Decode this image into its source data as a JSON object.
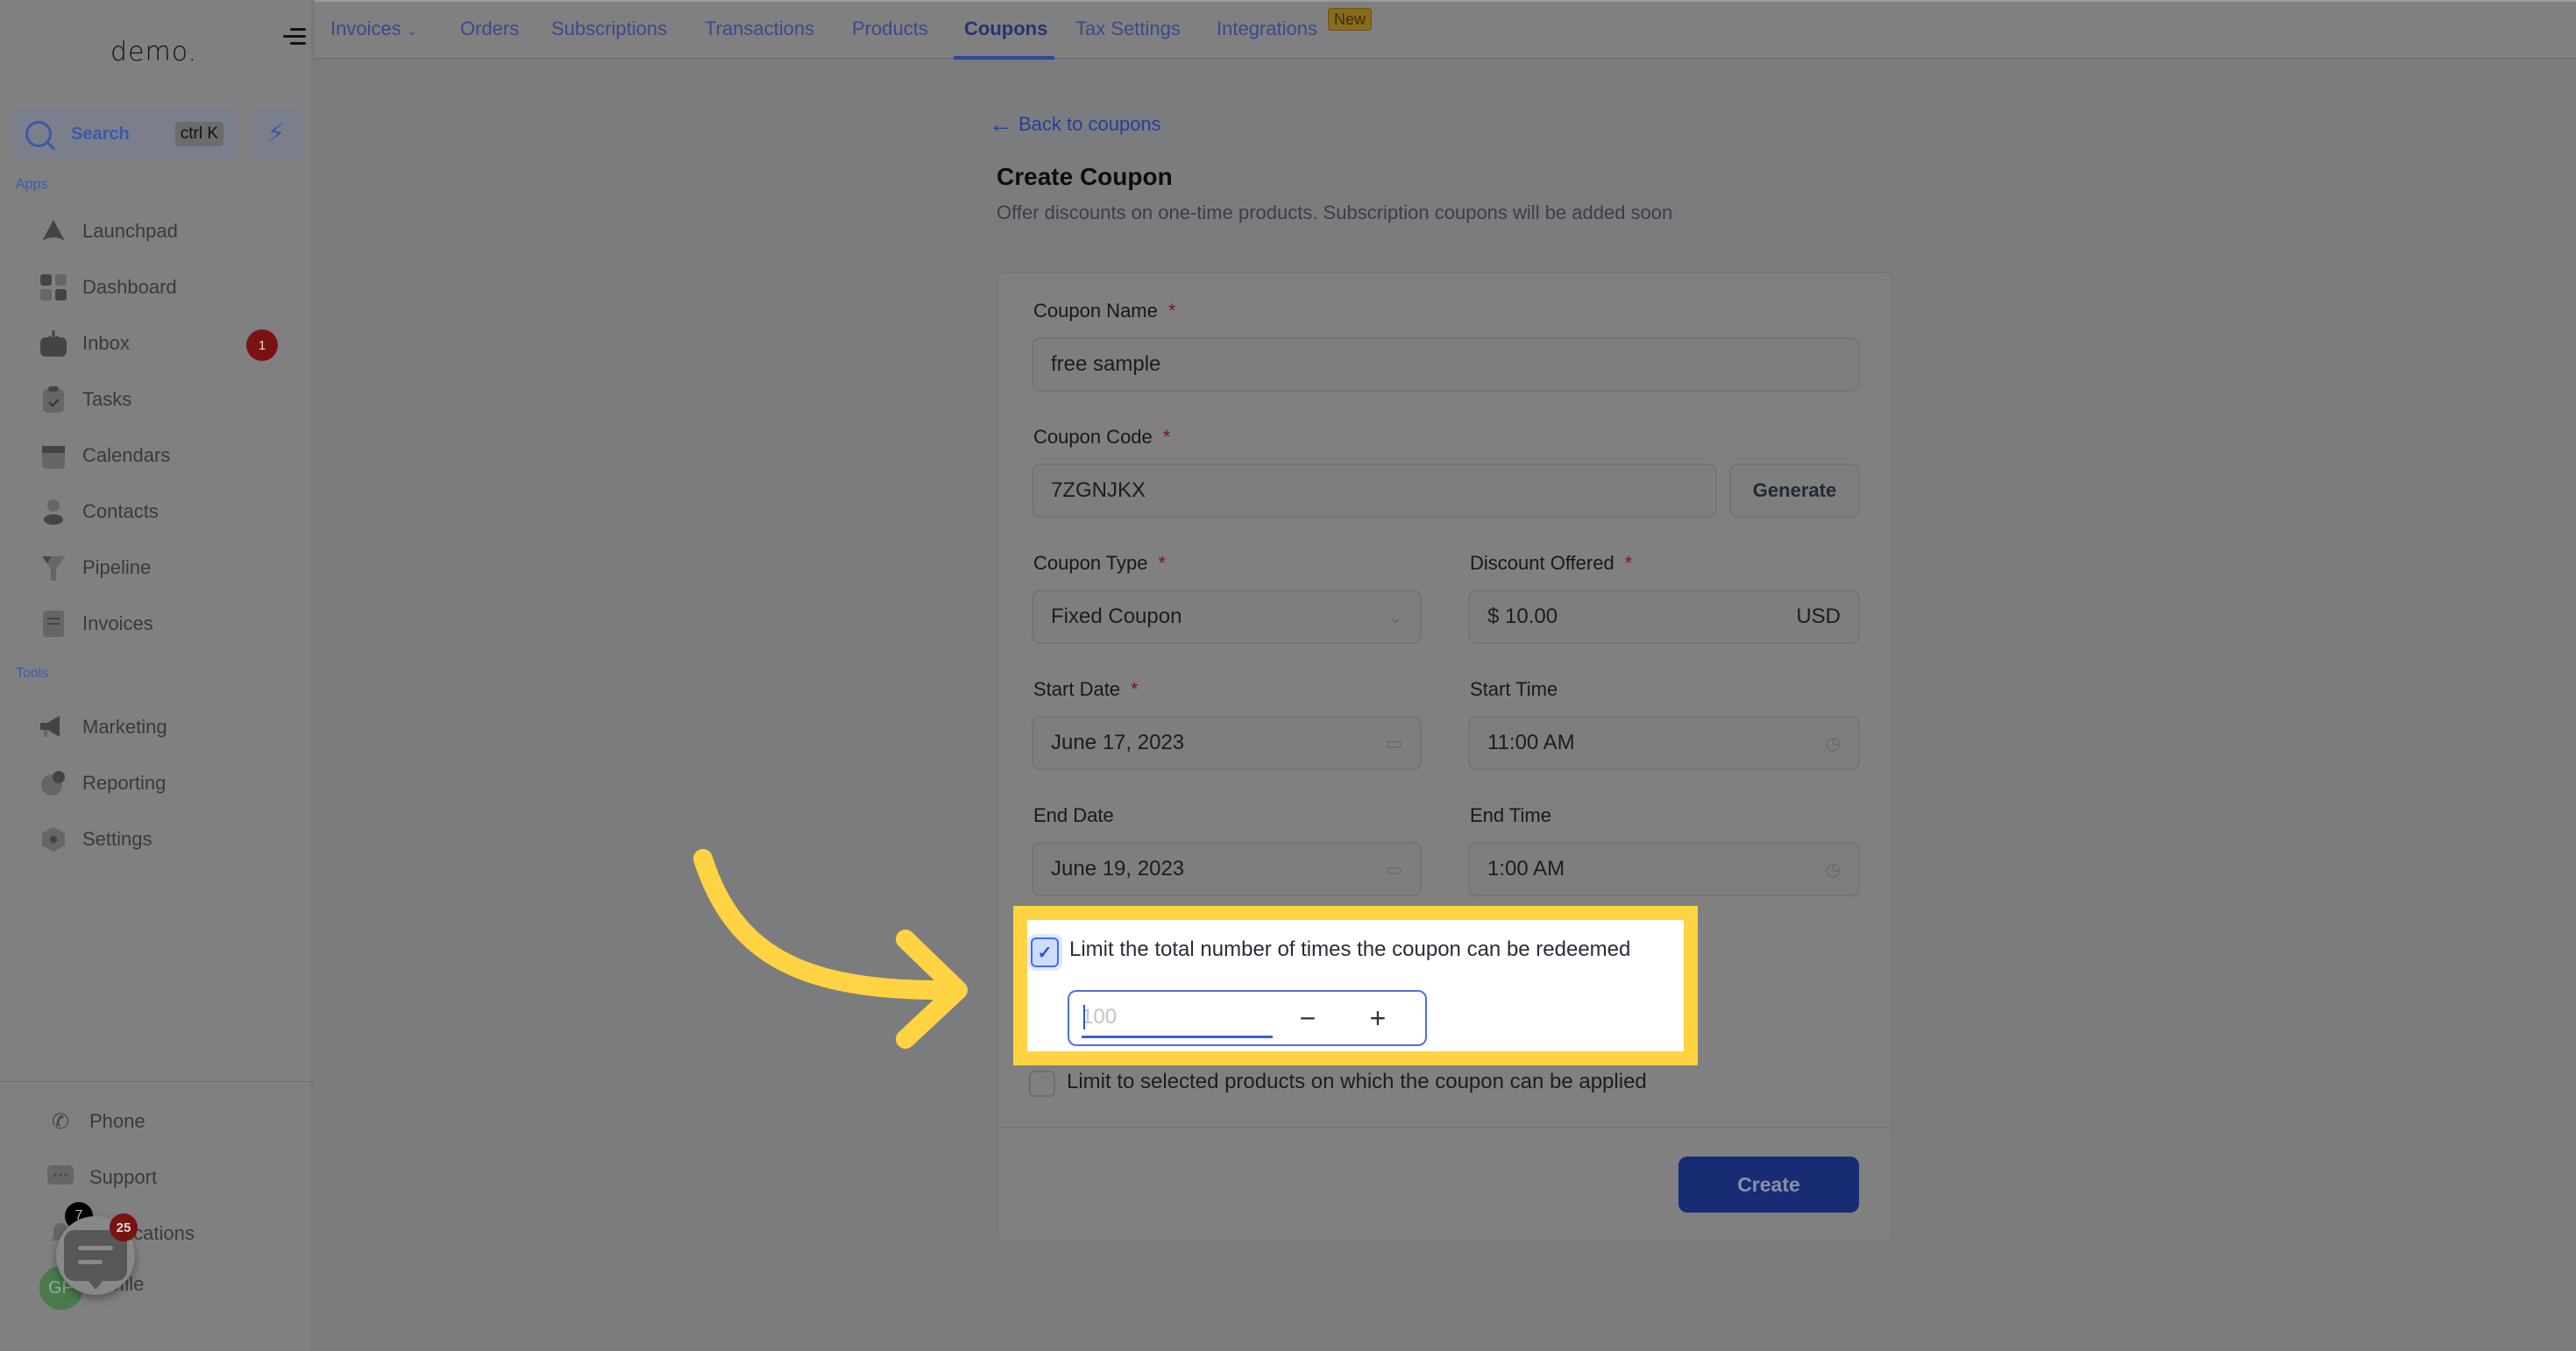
{
  "sidebar": {
    "logo": "demo.",
    "search": {
      "label": "Search",
      "shortcut": "ctrl K"
    },
    "apps_label": "Apps",
    "tools_label": "Tools",
    "apps": [
      {
        "label": "Launchpad",
        "icon": "rocket-icon"
      },
      {
        "label": "Dashboard",
        "icon": "grid-icon"
      },
      {
        "label": "Inbox",
        "icon": "inbox-icon",
        "badge": "1"
      },
      {
        "label": "Tasks",
        "icon": "clipboard-check-icon"
      },
      {
        "label": "Calendars",
        "icon": "calendar-icon"
      },
      {
        "label": "Contacts",
        "icon": "person-icon"
      },
      {
        "label": "Pipeline",
        "icon": "funnel-icon"
      },
      {
        "label": "Invoices",
        "icon": "receipt-icon"
      }
    ],
    "tools": [
      {
        "label": "Marketing",
        "icon": "megaphone-icon"
      },
      {
        "label": "Reporting",
        "icon": "pie-chart-icon"
      },
      {
        "label": "Settings",
        "icon": "gear-icon"
      }
    ],
    "bottom": [
      {
        "label": "Phone",
        "icon": "phone-icon"
      },
      {
        "label": "Support",
        "icon": "chat-dots-icon"
      },
      {
        "label": "Notifications",
        "icon": "bell-icon",
        "badge": "7"
      },
      {
        "label": "Profile",
        "icon": "avatar"
      }
    ],
    "avatar_initials": "GP",
    "chat_widget_badge": "25"
  },
  "topnav": {
    "tabs": [
      {
        "label": "Invoices",
        "has_dropdown": true
      },
      {
        "label": "Orders"
      },
      {
        "label": "Subscriptions"
      },
      {
        "label": "Transactions"
      },
      {
        "label": "Products"
      },
      {
        "label": "Coupons",
        "active": true
      },
      {
        "label": "Tax Settings"
      },
      {
        "label": "Integrations",
        "badge": "New"
      }
    ]
  },
  "page": {
    "back_link": "Back to coupons",
    "title": "Create Coupon",
    "subtitle": "Offer discounts on one-time products. Subscription coupons will be added soon"
  },
  "form": {
    "coupon_name": {
      "label": "Coupon Name",
      "required": "*",
      "value": "free sample"
    },
    "coupon_code": {
      "label": "Coupon Code",
      "required": "*",
      "value": "7ZGNJKX",
      "generate_label": "Generate"
    },
    "coupon_type": {
      "label": "Coupon Type",
      "required": "*",
      "value": "Fixed Coupon"
    },
    "discount_offered": {
      "label": "Discount Offered",
      "required": "*",
      "value": "$ 10.00",
      "currency": "USD"
    },
    "start_date": {
      "label": "Start Date",
      "required": "*",
      "value": "June 17, 2023"
    },
    "start_time": {
      "label": "Start Time",
      "value": "11:00 AM"
    },
    "end_date": {
      "label": "End Date",
      "value": "June 19, 2023"
    },
    "end_time": {
      "label": "End Time",
      "value": "1:00 AM"
    },
    "limit_redemptions": {
      "label": "Limit the total number of times the coupon can be redeemed",
      "checked": true,
      "placeholder": "100",
      "minus": "−",
      "plus": "+"
    },
    "limit_products": {
      "label": "Limit to selected products on which the coupon can be applied",
      "checked": false
    },
    "create_label": "Create"
  },
  "annotation": {
    "highlight_color": "#ffd342",
    "arrow_color": "#ffd342"
  }
}
